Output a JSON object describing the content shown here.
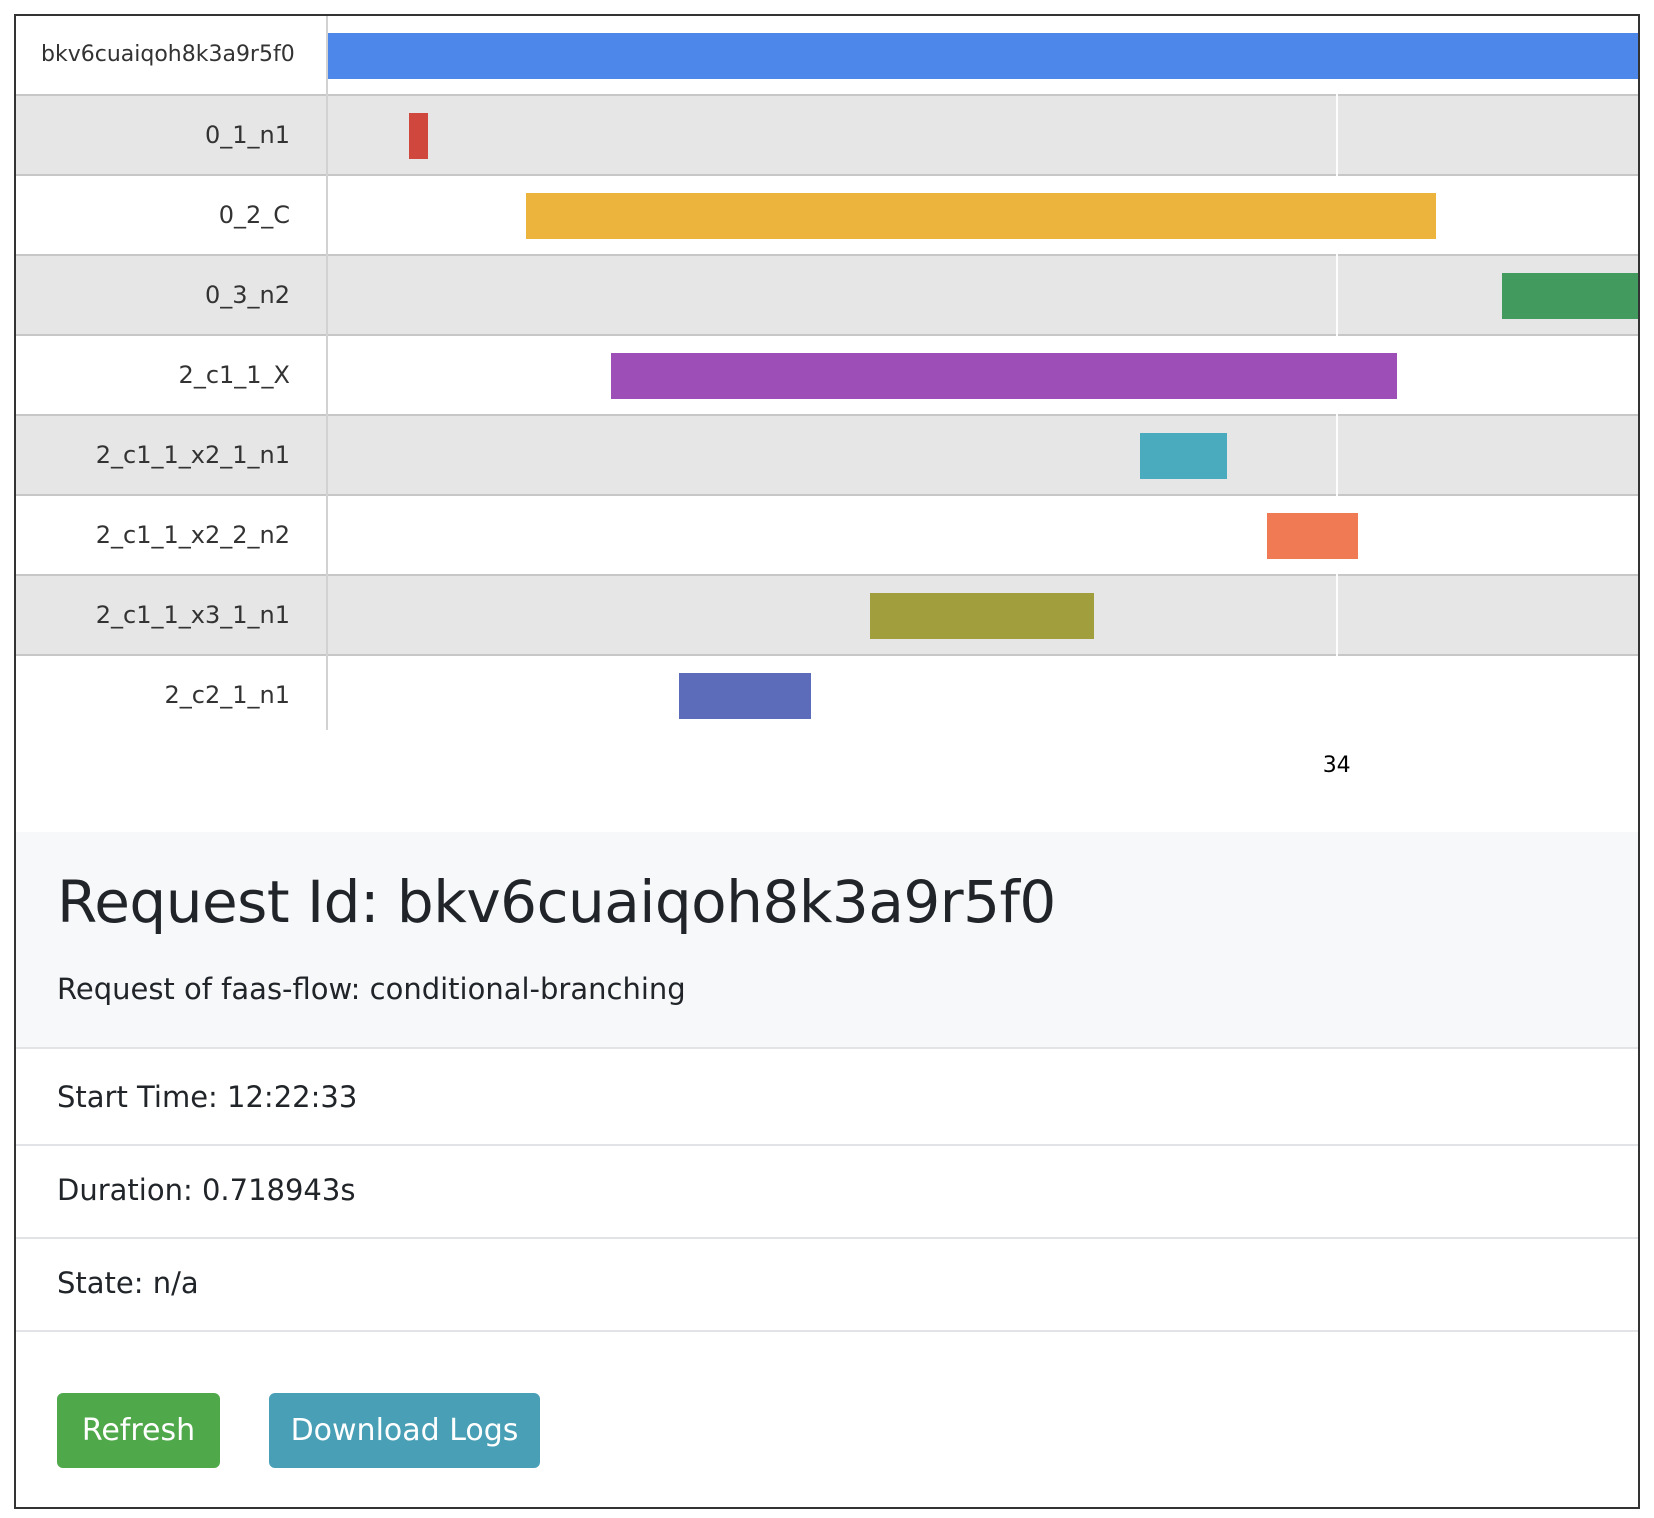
{
  "timeline": {
    "rows": [
      {
        "label": "bkv6cuaiqoh8k3a9r5f0",
        "color": "#4e87ea",
        "start": 0.0,
        "end": 1.0
      },
      {
        "label": "0_1_n1",
        "color": "#d0483d",
        "start": 0.062,
        "end": 0.076
      },
      {
        "label": "0_2_C",
        "color": "#ecb33d",
        "start": 0.151,
        "end": 0.846
      },
      {
        "label": "0_3_n2",
        "color": "#439a5f",
        "start": 0.896,
        "end": 1.0
      },
      {
        "label": "2_c1_1_X",
        "color": "#9d4fb7",
        "start": 0.216,
        "end": 0.816
      },
      {
        "label": "2_c1_1_x2_1_n1",
        "color": "#4aabbf",
        "start": 0.62,
        "end": 0.686
      },
      {
        "label": "2_c1_1_x2_2_n2",
        "color": "#ef7a53",
        "start": 0.717,
        "end": 0.786
      },
      {
        "label": "2_c1_1_x3_1_n1",
        "color": "#a19e3d",
        "start": 0.414,
        "end": 0.585
      },
      {
        "label": "2_c2_1_n1",
        "color": "#5d6bbb",
        "start": 0.268,
        "end": 0.369
      }
    ],
    "ticks": [
      {
        "label": "34",
        "pos": 0.77
      }
    ]
  },
  "request": {
    "title": "Request Id: bkv6cuaiqoh8k3a9r5f0",
    "subtitle": "Request of faas-flow: conditional-branching",
    "start_time": "Start Time: 12:22:33",
    "duration": "Duration: 0.718943s",
    "state": "State: n/a"
  },
  "buttons": {
    "refresh": "Refresh",
    "download_logs": "Download Logs"
  }
}
